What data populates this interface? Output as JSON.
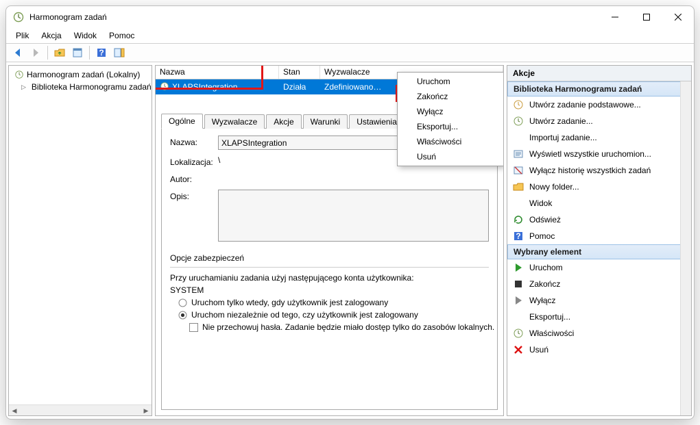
{
  "window": {
    "title": "Harmonogram zadań"
  },
  "menu": {
    "file": "Plik",
    "action": "Akcja",
    "view": "Widok",
    "help": "Pomoc"
  },
  "tree": {
    "root": "Harmonogram zadań (Lokalny)",
    "lib": "Biblioteka Harmonogramu zadań"
  },
  "tasklist": {
    "cols": {
      "name": "Nazwa",
      "state": "Stan",
      "triggers": "Wyzwalacze"
    },
    "row": {
      "name": "XLAPSIntegration",
      "state": "Działa",
      "triggers": "Zdefiniowano…"
    }
  },
  "context": {
    "run": "Uruchom",
    "end": "Zakończ",
    "disable": "Wyłącz",
    "export": "Eksportuj...",
    "props": "Właściwości",
    "delete": "Usuń"
  },
  "detail": {
    "tabs": {
      "general": "Ogólne",
      "triggers": "Wyzwalacze",
      "actions": "Akcje",
      "conditions": "Warunki",
      "settings": "Ustawienia"
    },
    "name_label": "Nazwa:",
    "name_value": "XLAPSIntegration",
    "loc_label": "Lokalizacja:",
    "loc_value": "\\",
    "author_label": "Autor:",
    "desc_label": "Opis:",
    "sec_header": "Opcje zabezpieczeń",
    "sec_text": "Przy uruchamianiu zadania użyj następującego konta użytkownika:",
    "account": "SYSTEM",
    "radio1": "Uruchom tylko wtedy, gdy użytkownik jest zalogowany",
    "radio2": "Uruchom niezależnie od tego, czy użytkownik jest zalogowany",
    "check1": "Nie przechowuj hasła. Zadanie będzie miało dostęp tylko do zasobów lokalnych."
  },
  "actions": {
    "title": "Akcje",
    "section1": "Biblioteka Harmonogramu zadań",
    "items1": {
      "create_basic": "Utwórz zadanie podstawowe...",
      "create": "Utwórz zadanie...",
      "import": "Importuj zadanie...",
      "show_running": "Wyświetl wszystkie uruchomion...",
      "disable_hist": "Wyłącz historię wszystkich zadań",
      "new_folder": "Nowy folder...",
      "view": "Widok",
      "refresh": "Odśwież",
      "help": "Pomoc"
    },
    "section2": "Wybrany element",
    "items2": {
      "run": "Uruchom",
      "end": "Zakończ",
      "disable": "Wyłącz",
      "export": "Eksportuj...",
      "props": "Właściwości",
      "delete": "Usuń"
    }
  }
}
